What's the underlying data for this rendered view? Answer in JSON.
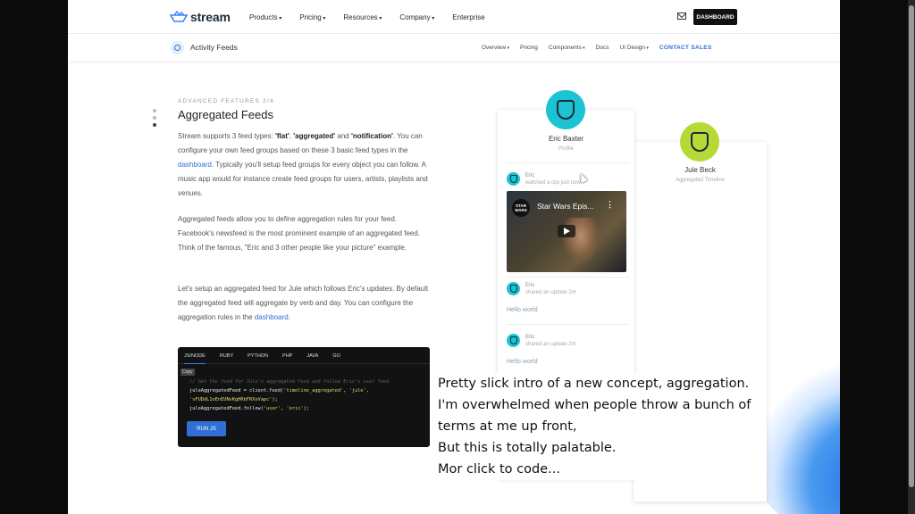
{
  "topnav": {
    "logo": "stream",
    "menu": [
      {
        "label": "Products",
        "caret": true
      },
      {
        "label": "Pricing",
        "caret": true
      },
      {
        "label": "Resources",
        "caret": true
      },
      {
        "label": "Company",
        "caret": true
      },
      {
        "label": "Enterprise",
        "caret": false
      }
    ],
    "dashboard_label": "DASHBOARD"
  },
  "subnav": {
    "title": "Activity Feeds",
    "menu": [
      {
        "label": "Overview",
        "caret": true
      },
      {
        "label": "Pricing",
        "caret": false
      },
      {
        "label": "Components",
        "caret": true
      },
      {
        "label": "Docs",
        "caret": false
      },
      {
        "label": "UI Design",
        "caret": true
      }
    ],
    "contact_label": "CONTACT SALES"
  },
  "content": {
    "eyebrow": "ADVANCED FEATURES 2/4",
    "heading": "Aggregated Feeds",
    "p1": {
      "a": "Stream supports 3 feed types: ",
      "flat": "'flat'",
      "b": ", ",
      "aggregated": "'aggregated'",
      "c": " and ",
      "notification": "'notification'",
      "d": ". You can configure your own feed groups based on these 3 basic feed types in the ",
      "link": "dashboard",
      "e": ". Typically you'll setup feed groups for every object you can follow. A music app would for instance create feed groups for users, artists, playlists and venues."
    },
    "p2": "Aggregated feeds allow you to define aggregation rules for your feed. Facebook's newsfeed is the most prominent example of an aggregated feed. Think of the famous, \"Eric and 3 other people like your picture\" example.",
    "p3": {
      "a": "Let's setup an aggregated feed for Jule which follows Eric's updates. By default the aggregated feed will aggregate by verb and day. You can configure the aggregation rules in the ",
      "link": "dashboard",
      "b": "."
    }
  },
  "code": {
    "tabs": [
      "JS/NODE",
      "RUBY",
      "PYTHON",
      "PHP",
      "JAVA",
      "GO"
    ],
    "active_tab": "JS/NODE",
    "copy_label": "Copy",
    "comment": "// Get the feed for Jule's aggregated feed and follow Eric's user feed",
    "line1_a": "juleAggregatedFeed = client.feed(",
    "line1_s1": "'timeline_aggregated'",
    "line1_b": ", ",
    "line1_s2": "'jule'",
    "line1_c": ",",
    "line2": "'vFUDdL1oEnEUNvKgHRbFRXoVapc'",
    "line2_end": ");",
    "line3_a": "juleAggregatedFeed.follow(",
    "line3_s1": "'user'",
    "line3_b": ", ",
    "line3_s2": "'eric'",
    "line3_c": ");",
    "run_label": "RUN JS"
  },
  "card1": {
    "name": "Eric Baxter",
    "subtitle": "Profile",
    "items": [
      {
        "name": "Eric",
        "sub": "watched a clip just now"
      },
      {
        "name": "Eric",
        "sub": "shared an update 2m",
        "text": "Hello world"
      },
      {
        "name": "Eric",
        "sub": "shared an update 2m",
        "text": "Hello world"
      }
    ],
    "video_title": "Star Wars Epis...",
    "video_logo": "STAR WARS"
  },
  "card2": {
    "name": "Jule Beck",
    "subtitle": "Aggregated Timeline"
  },
  "caption": "Pretty slick intro of a new concept, aggregation.\nI'm overwhelmed when people throw a bunch of\nterms at me up front,\nBut this is totally palatable.\nMor click to code..."
}
